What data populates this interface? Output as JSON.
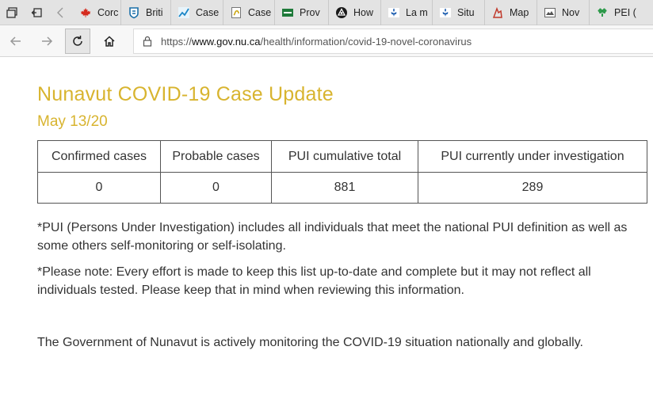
{
  "browser": {
    "tabs": [
      {
        "label": "Corc",
        "icon": "canada-flag-icon"
      },
      {
        "label": "Briti",
        "icon": "bc-shield-icon"
      },
      {
        "label": "Case",
        "icon": "chart-line-icon"
      },
      {
        "label": "Case",
        "icon": "document-icon"
      },
      {
        "label": "Prov",
        "icon": "green-banner-icon"
      },
      {
        "label": "How",
        "icon": "ontario-trillium-icon"
      },
      {
        "label": "La m",
        "icon": "quebec-flag-icon"
      },
      {
        "label": "Situ",
        "icon": "quebec-flag-icon"
      },
      {
        "label": "Map",
        "icon": "map-icon"
      },
      {
        "label": "Nov",
        "icon": "image-icon"
      },
      {
        "label": "PEI (",
        "icon": "pei-tree-icon"
      }
    ],
    "url_prefix": "https://",
    "url_host": "www.gov.nu.ca",
    "url_path": "/health/information/covid-19-novel-coronavirus"
  },
  "page": {
    "title": "Nunavut COVID-19 Case Update",
    "date": "May 13/20",
    "table": {
      "headers": [
        "Confirmed cases",
        "Probable cases",
        "PUI cumulative total",
        "PUI currently under investigation"
      ],
      "rows": [
        [
          "0",
          "0",
          "881",
          "289"
        ]
      ]
    },
    "note1": "*PUI (Persons Under Investigation) includes all individuals that meet the national PUI definition as well as some others self-monitoring or self-isolating.",
    "note2": "*Please note: Every effort is made to keep this list up-to-date and complete but it may not reflect all individuals tested. Please keep that in mind when reviewing this information.",
    "note3": "The Government of Nunavut is actively monitoring the COVID-19 situation nationally and globally."
  },
  "colors": {
    "heading": "#d8b42f",
    "text": "#333333",
    "tabbar": "#e3e3e3"
  }
}
